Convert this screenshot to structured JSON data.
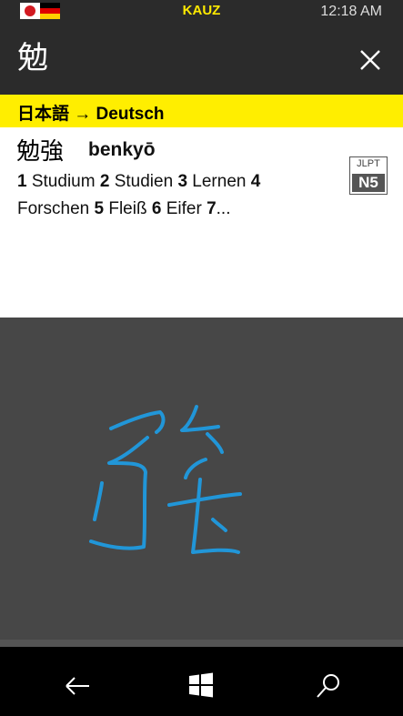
{
  "status_bar": {
    "app_name": "KAUZ",
    "time": "12:18 AM"
  },
  "search": {
    "query": "勉"
  },
  "language_pair": "日本語 → Deutsch",
  "result": {
    "word": "勉強",
    "reading": "benkyō",
    "meanings": [
      {
        "num": "1",
        "text": "Studium"
      },
      {
        "num": "2",
        "text": "Studien"
      },
      {
        "num": "3",
        "text": "Lernen"
      },
      {
        "num": "4",
        "text": "Forschen"
      },
      {
        "num": "5",
        "text": "Fleiß"
      },
      {
        "num": "6",
        "text": "Eifer"
      },
      {
        "num": "7",
        "text": "..."
      }
    ],
    "jlpt_label": "JLPT",
    "jlpt_level": "N5"
  },
  "app_bar": {
    "more_label": "..."
  },
  "colors": {
    "accent": "#ffee00",
    "ink": "#2196d8",
    "canvas": "#474747"
  }
}
